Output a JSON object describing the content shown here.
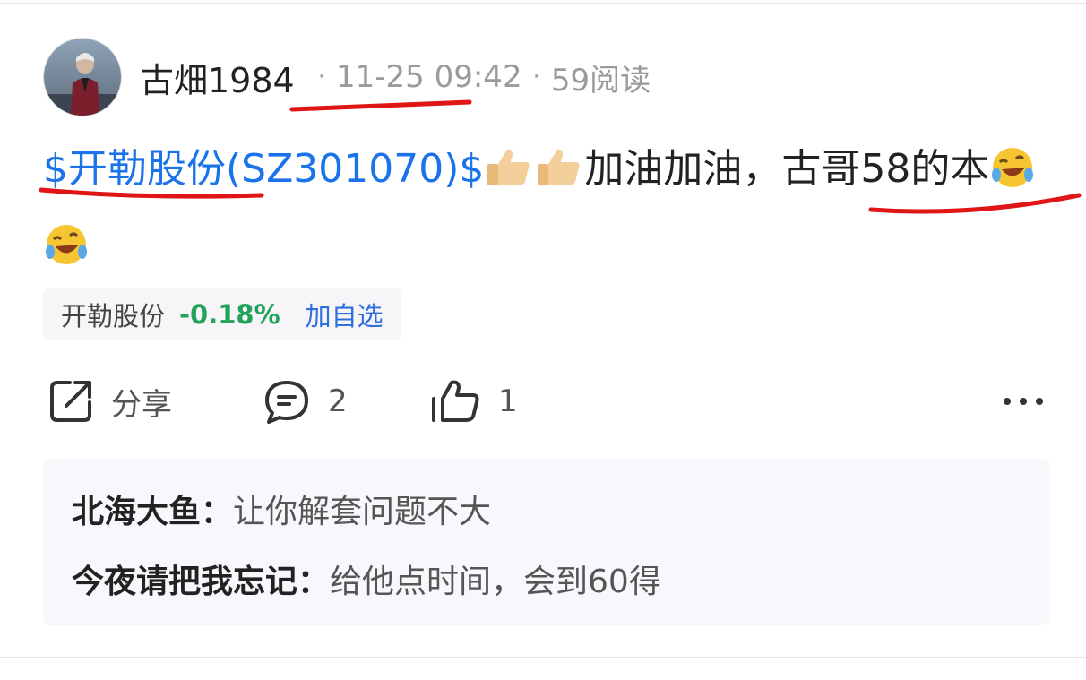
{
  "post": {
    "author": "古畑1984",
    "time": "11-25 09:42",
    "reads": "59阅读",
    "dot": "·",
    "stock_link": "$开勒股份(SZ301070)$",
    "text_main": "加油加油，古哥58的本",
    "emoji_thumbs": "thumbs-up",
    "emoji_laugh": "rolling-laughing"
  },
  "stock_chip": {
    "name": "开勒股份",
    "change": "-0.18%",
    "add_label": "加自选",
    "change_color": "#21a35a"
  },
  "actions": {
    "share_label": "分享",
    "comment_count": "2",
    "like_count": "1",
    "more_icon": "more-dots-icon"
  },
  "comments": [
    {
      "author": "北海大鱼：",
      "text": "让你解套问题不大"
    },
    {
      "author": "今夜请把我忘记：",
      "text": "给他点时间，会到60得"
    }
  ],
  "colors": {
    "link": "#1a73e8",
    "annotation": "#e01515",
    "chip_bg": "#f7f5f8",
    "comments_bg": "#faf7fc"
  }
}
